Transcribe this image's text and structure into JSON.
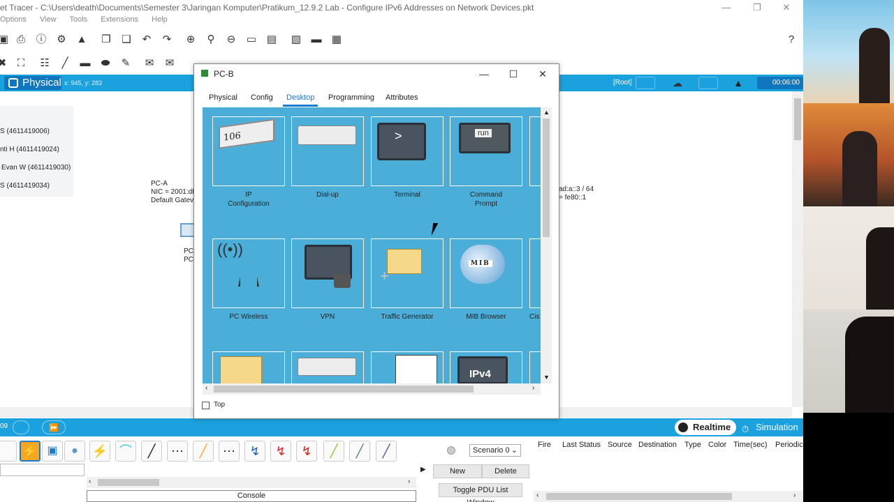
{
  "window": {
    "title": "et Tracer - C:\\Users\\death\\Documents\\Semester 3\\Jaringan Komputer\\Pratikum_12.9.2 Lab - Configure IPv6 Addresses on Network Devices.pkt"
  },
  "menu": [
    "Options",
    "View",
    "Tools",
    "Extensions",
    "Help"
  ],
  "bluebar": {
    "mode": "Physical",
    "coords": "x: 945, y: 283",
    "root": "[Root]",
    "timer": "00:06:00"
  },
  "legend": [
    "S (4611419006)",
    "nti H (4611419024)",
    "Evan W (4611419030)",
    "S (4611419034)"
  ],
  "pc_a": {
    "line1": "PC-A",
    "line2": "NIC = 2001:db",
    "line3": "Default Gatev"
  },
  "pc_a_icon": {
    "line1": "PC-",
    "line2": "PC"
  },
  "right_label": {
    "line1": "ad:a::3 / 64",
    "line2": "= fe80::1"
  },
  "bottom": {
    "realtime": "Realtime",
    "simulation": "Simulation",
    "console": "Console",
    "left_num": "09"
  },
  "scenario": {
    "selected": "Scenario 0",
    "new_label": "New",
    "delete_label": "Delete",
    "toggle_label": "Toggle PDU List Window"
  },
  "pdu_columns": [
    "Fire",
    "Last Status",
    "Source",
    "Destination",
    "Type",
    "Color",
    "Time(sec)",
    "Periodic"
  ],
  "dialog": {
    "title": "PC-B",
    "tabs": [
      "Physical",
      "Config",
      "Desktop",
      "Programming",
      "Attributes"
    ],
    "active_tab": "Desktop",
    "top_checkbox_label": "Top",
    "apps": [
      {
        "label": "IP\nConfiguration",
        "icon": "ip-config-icon",
        "icon_text": "106"
      },
      {
        "label": "Dial-up",
        "icon": "dialup-icon"
      },
      {
        "label": "Terminal",
        "icon": "terminal-icon",
        "icon_text": ">"
      },
      {
        "label": "Command\nPrompt",
        "icon": "command-prompt-icon",
        "icon_text": "run"
      },
      {
        "label": "PC Wireless",
        "icon": "wireless-icon"
      },
      {
        "label": "VPN",
        "icon": "vpn-icon"
      },
      {
        "label": "Traffic Generator",
        "icon": "traffic-generator-icon"
      },
      {
        "label": "MIB Browser",
        "icon": "mib-browser-icon",
        "icon_text": "MIB"
      },
      {
        "label": "Cis",
        "icon": "cisco-icon"
      }
    ],
    "row3_icon_text": "IPv4"
  },
  "colors": {
    "accent": "#1ba1de",
    "desktop_bg": "#4aaed8",
    "dark_blue": "#1076bd"
  }
}
